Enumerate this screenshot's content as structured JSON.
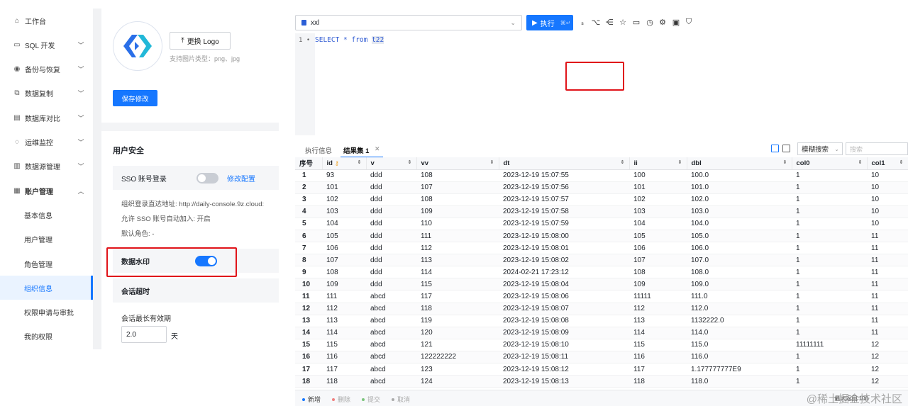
{
  "sidebar": {
    "items": [
      {
        "icon": "home-icon",
        "glyph": "⌂",
        "label": "工作台",
        "expandable": false
      },
      {
        "icon": "sql-dev-icon",
        "glyph": "▭",
        "label": "SQL 开发",
        "expandable": true
      },
      {
        "icon": "backup-icon",
        "glyph": "◉",
        "label": "备份与恢复",
        "expandable": true
      },
      {
        "icon": "replication-icon",
        "glyph": "⧉",
        "label": "数据复制",
        "expandable": true
      },
      {
        "icon": "db-compare-icon",
        "glyph": "▤",
        "label": "数据库对比",
        "expandable": true
      },
      {
        "icon": "ops-monitor-icon",
        "glyph": "◌",
        "label": "运维监控",
        "expandable": true
      },
      {
        "icon": "datasource-icon",
        "glyph": "▥",
        "label": "数据源管理",
        "expandable": true
      },
      {
        "icon": "account-icon",
        "glyph": "▦",
        "label": "账户管理",
        "expandable": true,
        "expanded": true
      }
    ],
    "sub_items": [
      {
        "label": "基本信息",
        "active": false
      },
      {
        "label": "用户管理",
        "active": false
      },
      {
        "label": "角色管理",
        "active": false
      },
      {
        "label": "组织信息",
        "active": true
      },
      {
        "label": "权限申请与审批",
        "active": false
      },
      {
        "label": "我的权限",
        "active": false
      }
    ]
  },
  "org": {
    "change_logo_label": "更换 Logo",
    "logo_hint": "支持图片类型：png、jpg",
    "save_label": "保存修改"
  },
  "security": {
    "title": "用户安全",
    "sso_label": "SSO 账号登录",
    "sso_enabled": false,
    "sso_edit_label": "修改配置",
    "login_url_line": "组织登录直达地址: http://daily-console.9z.cloud:",
    "auto_join_line": "允许 SSO 账号自动加入: 开启",
    "default_role_line": "默认角色: -",
    "watermark_label": "数据水印",
    "watermark_enabled": true,
    "session_timeout_label": "会话超时",
    "session_max_label": "会话最长有效期",
    "session_value": "2.0",
    "session_unit": "天"
  },
  "editor": {
    "database": "xxl",
    "execute_label": "执行",
    "execute_shortcut": "⌘↵",
    "toolbar_icons": [
      "sql-format-icon",
      "paint-brush-icon",
      "share-icon",
      "star-icon",
      "folder-icon",
      "history-icon",
      "settings-icon",
      "image-export-icon",
      "shield-icon"
    ],
    "line_number": "1",
    "sql_keyword": "SELECT * from ",
    "sql_table": "t22"
  },
  "results": {
    "tab_exec_info": "执行信息",
    "tab_result": "结果集 1",
    "search_mode": "模糊搜索",
    "search_placeholder": "搜索",
    "columns": [
      "序号",
      "id",
      "v",
      "vv",
      "dt",
      "ii",
      "dbl",
      "col0",
      "col1"
    ],
    "rows": [
      [
        "1",
        "93",
        "ddd",
        "108",
        "2023-12-19 15:07:55",
        "100",
        "100.0",
        "1",
        "10"
      ],
      [
        "2",
        "101",
        "ddd",
        "107",
        "2023-12-19 15:07:56",
        "101",
        "101.0",
        "1",
        "10"
      ],
      [
        "3",
        "102",
        "ddd",
        "108",
        "2023-12-19 15:07:57",
        "102",
        "102.0",
        "1",
        "10"
      ],
      [
        "4",
        "103",
        "ddd",
        "109",
        "2023-12-19 15:07:58",
        "103",
        "103.0",
        "1",
        "10"
      ],
      [
        "5",
        "104",
        "ddd",
        "110",
        "2023-12-19 15:07:59",
        "104",
        "104.0",
        "1",
        "10"
      ],
      [
        "6",
        "105",
        "ddd",
        "111",
        "2023-12-19 15:08:00",
        "105",
        "105.0",
        "1",
        "11"
      ],
      [
        "7",
        "106",
        "ddd",
        "112",
        "2023-12-19 15:08:01",
        "106",
        "106.0",
        "1",
        "11"
      ],
      [
        "8",
        "107",
        "ddd",
        "113",
        "2023-12-19 15:08:02",
        "107",
        "107.0",
        "1",
        "11"
      ],
      [
        "9",
        "108",
        "ddd",
        "114",
        "2024-02-21 17:23:12",
        "108",
        "108.0",
        "1",
        "11"
      ],
      [
        "10",
        "109",
        "ddd",
        "115",
        "2023-12-19 15:08:04",
        "109",
        "109.0",
        "1",
        "11"
      ],
      [
        "11",
        "111",
        "abcd",
        "117",
        "2023-12-19 15:08:06",
        "11111",
        "111.0",
        "1",
        "11"
      ],
      [
        "12",
        "112",
        "abcd",
        "118",
        "2023-12-19 15:08:07",
        "112",
        "112.0",
        "1",
        "11"
      ],
      [
        "13",
        "113",
        "abcd",
        "119",
        "2023-12-19 15:08:08",
        "113",
        "1132222.0",
        "1",
        "11"
      ],
      [
        "14",
        "114",
        "abcd",
        "120",
        "2023-12-19 15:08:09",
        "114",
        "114.0",
        "1",
        "11"
      ],
      [
        "15",
        "115",
        "abcd",
        "121",
        "2023-12-19 15:08:10",
        "115",
        "115.0",
        "11111111",
        "12"
      ],
      [
        "16",
        "116",
        "abcd",
        "122222222",
        "2023-12-19 15:08:11",
        "116",
        "116.0",
        "1",
        "12"
      ],
      [
        "17",
        "117",
        "abcd",
        "123",
        "2023-12-19 15:08:12",
        "117",
        "1.177777777E9",
        "1",
        "12"
      ],
      [
        "18",
        "118",
        "abcd",
        "124",
        "2023-12-19 15:08:13",
        "118",
        "118.0",
        "1",
        "12"
      ]
    ]
  },
  "footer": {
    "add_label": "新增",
    "delete_label": "删除",
    "submit_label": "提交",
    "cancel_label": "取消",
    "info_text": "最大返回 100",
    "watermark_text": "@稀土掘金技术社区"
  },
  "colors": {
    "accent": "#1677ff",
    "highlight_box": "#e0141a",
    "logo_blue": "#2a6fe8",
    "logo_cyan": "#22b8d8"
  }
}
